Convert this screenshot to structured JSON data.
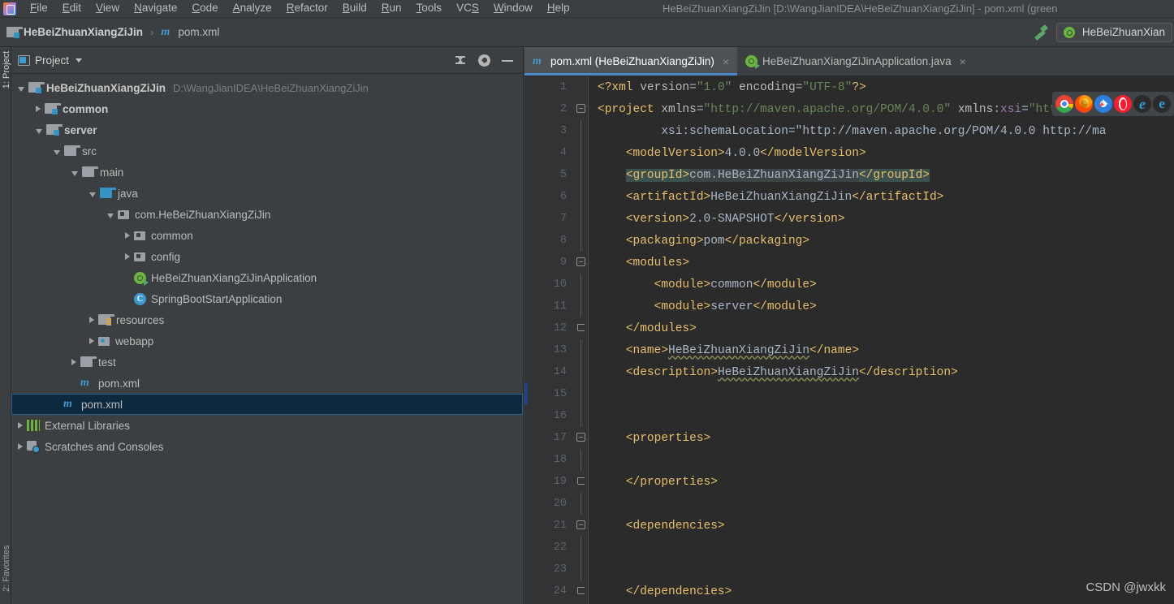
{
  "window": {
    "title": "HeBeiZhuanXiangZiJin [D:\\WangJianIDEA\\HeBeiZhuanXiangZiJin] - pom.xml (green",
    "watermark": "CSDN @jwxkk"
  },
  "menubar": {
    "logo_icon": "intellij-idea-logo-icon",
    "items": [
      {
        "label": "File",
        "mnemonic": "F"
      },
      {
        "label": "Edit",
        "mnemonic": "E"
      },
      {
        "label": "View",
        "mnemonic": "V"
      },
      {
        "label": "Navigate",
        "mnemonic": "N"
      },
      {
        "label": "Code",
        "mnemonic": "C"
      },
      {
        "label": "Analyze",
        "mnemonic": "A"
      },
      {
        "label": "Refactor",
        "mnemonic": "R"
      },
      {
        "label": "Build",
        "mnemonic": "B"
      },
      {
        "label": "Run",
        "mnemonic": "R"
      },
      {
        "label": "Tools",
        "mnemonic": "T"
      },
      {
        "label": "VCS",
        "mnemonic": "S"
      },
      {
        "label": "Window",
        "mnemonic": "W"
      },
      {
        "label": "Help",
        "mnemonic": "H"
      }
    ]
  },
  "navbar": {
    "breadcrumb": [
      {
        "label": "HeBeiZhuanXiangZiJin",
        "icon": "module-icon",
        "bold": true
      },
      {
        "label": "pom.xml",
        "icon": "maven-icon",
        "bold": false
      }
    ],
    "separator": "›",
    "build_icon": "hammer-build-icon",
    "run_config": {
      "label": "HeBeiZhuanXian",
      "icon": "spring-boot-icon"
    }
  },
  "left_strip": {
    "tabs": [
      {
        "label": "1: Project",
        "active": true
      },
      {
        "label": "2: Favorites",
        "active": false
      }
    ]
  },
  "project_panel": {
    "title": "Project",
    "view_icon": "project-view-icon",
    "dropdown_icon": "chevron-down-icon",
    "tools": [
      {
        "name": "collapse-all-icon",
        "label": "Collapse All"
      },
      {
        "name": "gear-icon",
        "label": "Settings"
      },
      {
        "name": "minimize-icon",
        "label": "Hide"
      }
    ],
    "tree": [
      {
        "label": "HeBeiZhuanXiangZiJin",
        "path": "D:\\WangJianIDEA\\HeBeiZhuanXiangZiJin",
        "indent": 0,
        "twist": "expanded",
        "icon": "module-icon",
        "bold": true,
        "selected": false
      },
      {
        "label": "common",
        "path": "",
        "indent": 1,
        "twist": "collapsed",
        "icon": "module-icon",
        "bold": true,
        "selected": false
      },
      {
        "label": "server",
        "path": "",
        "indent": 1,
        "twist": "expanded",
        "icon": "module-icon",
        "bold": true,
        "selected": false
      },
      {
        "label": "src",
        "path": "",
        "indent": 2,
        "twist": "expanded",
        "icon": "folder-icon",
        "bold": false,
        "selected": false
      },
      {
        "label": "main",
        "path": "",
        "indent": 3,
        "twist": "expanded",
        "icon": "folder-icon",
        "bold": false,
        "selected": false
      },
      {
        "label": "java",
        "path": "",
        "indent": 4,
        "twist": "expanded",
        "icon": "source-folder-icon",
        "bold": false,
        "selected": false
      },
      {
        "label": "com.HeBeiZhuanXiangZiJin",
        "path": "",
        "indent": 5,
        "twist": "expanded",
        "icon": "package-icon",
        "bold": false,
        "selected": false
      },
      {
        "label": "common",
        "path": "",
        "indent": 6,
        "twist": "collapsed",
        "icon": "package-icon",
        "bold": false,
        "selected": false
      },
      {
        "label": "config",
        "path": "",
        "indent": 6,
        "twist": "collapsed",
        "icon": "package-icon",
        "bold": false,
        "selected": false
      },
      {
        "label": "HeBeiZhuanXiangZiJinApplication",
        "path": "",
        "indent": 6,
        "twist": "none",
        "icon": "spring-boot-class-icon",
        "bold": false,
        "selected": false
      },
      {
        "label": "SpringBootStartApplication",
        "path": "",
        "indent": 6,
        "twist": "none",
        "icon": "java-class-icon",
        "bold": false,
        "selected": false
      },
      {
        "label": "resources",
        "path": "",
        "indent": 4,
        "twist": "collapsed",
        "icon": "resources-folder-icon",
        "bold": false,
        "selected": false
      },
      {
        "label": "webapp",
        "path": "",
        "indent": 4,
        "twist": "collapsed",
        "icon": "webapp-folder-icon",
        "bold": false,
        "selected": false
      },
      {
        "label": "test",
        "path": "",
        "indent": 3,
        "twist": "collapsed",
        "icon": "folder-icon",
        "bold": false,
        "selected": false
      },
      {
        "label": "pom.xml",
        "path": "",
        "indent": 3,
        "twist": "none",
        "icon": "maven-icon",
        "bold": false,
        "selected": false
      },
      {
        "label": "pom.xml",
        "path": "",
        "indent": 2,
        "twist": "none",
        "icon": "maven-icon",
        "bold": false,
        "selected": true
      },
      {
        "label": "External Libraries",
        "path": "",
        "indent": 0,
        "twist": "collapsed",
        "icon": "external-libraries-icon",
        "bold": false,
        "selected": false
      },
      {
        "label": "Scratches and Consoles",
        "path": "",
        "indent": 0,
        "twist": "collapsed",
        "icon": "scratches-icon",
        "bold": false,
        "selected": false
      }
    ]
  },
  "editor": {
    "tabs": [
      {
        "label": "pom.xml (HeBeiZhuanXiangZiJin)",
        "icon": "maven-icon",
        "active": true,
        "close_icon": "close-icon"
      },
      {
        "label": "HeBeiZhuanXiangZiJinApplication.java",
        "icon": "spring-boot-class-icon",
        "active": false,
        "close_icon": "close-icon"
      }
    ],
    "language": "xml",
    "file": "pom.xml",
    "line_numbers": [
      1,
      2,
      3,
      4,
      5,
      6,
      7,
      8,
      9,
      10,
      11,
      12,
      13,
      14,
      15,
      16,
      17,
      18,
      19,
      20,
      21,
      22,
      23,
      24
    ],
    "caret_line": 15,
    "lines": [
      {
        "num": 1,
        "fold": "none",
        "text": "<?xml version=\"1.0\" encoding=\"UTF-8\"?>"
      },
      {
        "num": 2,
        "fold": "minus",
        "text": "<project xmlns=\"http://maven.apache.org/POM/4.0.0\" xmlns:xsi=\"http://www."
      },
      {
        "num": 3,
        "fold": "guide",
        "text": "         xsi:schemaLocation=\"http://maven.apache.org/POM/4.0.0 http://ma"
      },
      {
        "num": 4,
        "fold": "guide",
        "text": "    <modelVersion>4.0.0</modelVersion>"
      },
      {
        "num": 5,
        "fold": "guide",
        "text": "    <groupId>com.HeBeiZhuanXiangZiJin</groupId>"
      },
      {
        "num": 6,
        "fold": "guide",
        "text": "    <artifactId>HeBeiZhuanXiangZiJin</artifactId>"
      },
      {
        "num": 7,
        "fold": "guide",
        "text": "    <version>2.0-SNAPSHOT</version>"
      },
      {
        "num": 8,
        "fold": "guide",
        "text": "    <packaging>pom</packaging>"
      },
      {
        "num": 9,
        "fold": "minus",
        "text": "    <modules>"
      },
      {
        "num": 10,
        "fold": "guide",
        "text": "        <module>common</module>"
      },
      {
        "num": 11,
        "fold": "guide",
        "text": "        <module>server</module>"
      },
      {
        "num": 12,
        "fold": "end",
        "text": "    </modules>"
      },
      {
        "num": 13,
        "fold": "guide",
        "text": "    <name>HeBeiZhuanXiangZiJin</name>"
      },
      {
        "num": 14,
        "fold": "guide",
        "text": "    <description>HeBeiZhuanXiangZiJin</description>"
      },
      {
        "num": 15,
        "fold": "guide",
        "text": ""
      },
      {
        "num": 16,
        "fold": "guide",
        "text": ""
      },
      {
        "num": 17,
        "fold": "minus",
        "text": "    <properties>"
      },
      {
        "num": 18,
        "fold": "guide",
        "text": ""
      },
      {
        "num": 19,
        "fold": "end",
        "text": "    </properties>"
      },
      {
        "num": 20,
        "fold": "guide",
        "text": ""
      },
      {
        "num": 21,
        "fold": "minus",
        "text": "    <dependencies>"
      },
      {
        "num": 22,
        "fold": "guide",
        "text": ""
      },
      {
        "num": 23,
        "fold": "guide",
        "text": ""
      },
      {
        "num": 24,
        "fold": "end",
        "text": "    </dependencies>"
      }
    ]
  },
  "browser_popup": {
    "icons": [
      {
        "name": "chrome-icon",
        "label": "Chrome"
      },
      {
        "name": "firefox-icon",
        "label": "Firefox"
      },
      {
        "name": "safari-icon",
        "label": "Safari"
      },
      {
        "name": "opera-icon",
        "label": "Opera"
      },
      {
        "name": "edge-icon",
        "label": "Edge"
      },
      {
        "name": "internet-explorer-icon",
        "label": "Internet Explorer"
      }
    ],
    "edge_glyph": "e",
    "ie_glyph": "e"
  },
  "colors": {
    "window_bg": "#3c3f41",
    "editor_bg": "#2b2b2b",
    "gutter_bg": "#313335",
    "tab_active_bg": "#4e5254",
    "tab_underline": "#4a88c7",
    "tree_selection": "#0d293e",
    "tree_selection_border": "#2f6391",
    "xml_tag": "#e8bf6a",
    "xml_text": "#a9b7c6",
    "xml_attr_value": "#6a8759",
    "xml_namespace": "#9876aa",
    "line_number": "#606366",
    "brace_highlight": "#3b514d",
    "accent_green": "#59a869",
    "accent_blue": "#3592c4"
  }
}
